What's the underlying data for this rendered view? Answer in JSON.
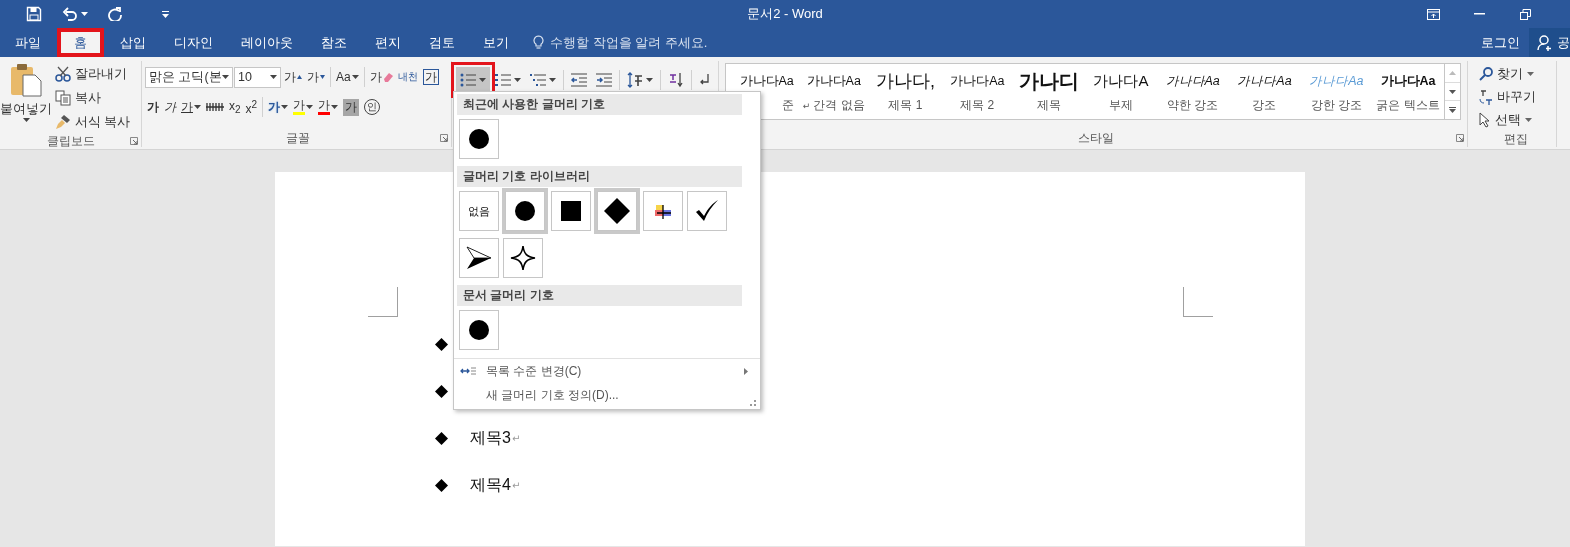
{
  "window": {
    "title": "문서2 - Word"
  },
  "tabs": [
    {
      "label": "파일",
      "selected": false,
      "marked": false
    },
    {
      "label": "홈",
      "selected": true,
      "marked": true
    },
    {
      "label": "삽입",
      "selected": false,
      "marked": false
    },
    {
      "label": "디자인",
      "selected": false,
      "marked": false
    },
    {
      "label": "레이아웃",
      "selected": false,
      "marked": false
    },
    {
      "label": "참조",
      "selected": false,
      "marked": false
    },
    {
      "label": "편지",
      "selected": false,
      "marked": false
    },
    {
      "label": "검토",
      "selected": false,
      "marked": false
    },
    {
      "label": "보기",
      "selected": false,
      "marked": false
    }
  ],
  "tell_me": {
    "placeholder": "수행할 작업을 알려 주세요."
  },
  "account": {
    "sign_in": "로그인",
    "share": "공"
  },
  "clipboard": {
    "paste": "붙여넣기",
    "group_label": "클립보드",
    "actions": [
      {
        "kind": "cut",
        "label": "잘라내기"
      },
      {
        "kind": "copy",
        "label": "복사"
      },
      {
        "kind": "painter",
        "label": "서식 복사"
      }
    ]
  },
  "font": {
    "name": "맑은 고딕(본",
    "size": "10",
    "group_label": "글꼴",
    "row1": [
      {
        "kind": "grow",
        "text": "가",
        "dropdown": false
      },
      {
        "kind": "shrink",
        "text": "가",
        "dropdown": false
      },
      {
        "kind": "sep"
      },
      {
        "kind": "case",
        "text": "Aa",
        "dropdown": true
      },
      {
        "kind": "sep"
      },
      {
        "kind": "clear",
        "text": "가",
        "dropdown": false
      },
      {
        "kind": "phonetic",
        "text": "내천",
        "dropdown": false
      },
      {
        "kind": "border",
        "text": "가",
        "dropdown": false
      }
    ],
    "row2": [
      {
        "kind": "bold",
        "text": "가",
        "dropdown": false
      },
      {
        "kind": "italic",
        "text": "가",
        "dropdown": false
      },
      {
        "kind": "underline",
        "text": "가",
        "dropdown": true
      },
      {
        "kind": "strike",
        "dropdown": false
      },
      {
        "kind": "plain",
        "text": "x$_{2}$",
        "dropdown": false
      },
      {
        "kind": "plain",
        "text": "x$^{2}$",
        "dropdown": false
      },
      {
        "kind": "sep"
      },
      {
        "kind": "effects",
        "text": "가",
        "dropdown": true
      },
      {
        "kind": "highlight",
        "text": "가",
        "dropdown": true
      },
      {
        "kind": "color",
        "text": "가",
        "dropdown": true
      },
      {
        "kind": "shading",
        "text": "가",
        "dropdown": false
      },
      {
        "kind": "enclose",
        "text": "인",
        "dropdown": false
      }
    ]
  },
  "paragraph": {
    "buttons": [
      {
        "kind": "bullets",
        "dropdown": true,
        "marked": true
      },
      {
        "kind": "numbering",
        "dropdown": true,
        "marked": false
      },
      {
        "kind": "multilevel",
        "dropdown": true,
        "marked": false
      },
      {
        "kind": "sep"
      },
      {
        "kind": "outdent",
        "dropdown": false,
        "marked": false
      },
      {
        "kind": "indent",
        "dropdown": false,
        "marked": false
      },
      {
        "kind": "sep"
      },
      {
        "kind": "spacing",
        "dropdown": true,
        "marked": false
      },
      {
        "kind": "sep"
      },
      {
        "kind": "sort",
        "dropdown": false,
        "marked": false
      },
      {
        "kind": "sep"
      },
      {
        "kind": "marks",
        "dropdown": false,
        "marked": false
      }
    ]
  },
  "styles": {
    "group_label": "스타일",
    "items": [
      {
        "preview": "가나다Aa",
        "label": "준",
        "kind": "plain"
      },
      {
        "preview": "가나다Aa",
        "label": "간격 없음",
        "prefix": "↵",
        "kind": "plain"
      },
      {
        "preview": "가나다,",
        "label": "제목 1",
        "kind": "large"
      },
      {
        "preview": "가나다Aa",
        "label": "제목 2",
        "kind": "plain"
      },
      {
        "preview": "가나디",
        "label": "제목",
        "kind": "heavy"
      },
      {
        "preview": "가나다A",
        "label": "부제",
        "kind": "medium"
      },
      {
        "preview": "가나다Aa",
        "label": "약한 강조",
        "kind": "italic"
      },
      {
        "preview": "가나다Aa",
        "label": "강조",
        "kind": "italic"
      },
      {
        "preview": "가나다Aa",
        "label": "강한 강조",
        "kind": "accent"
      },
      {
        "preview": "가나다Aa",
        "label": "굵은 텍스트",
        "kind": "bold"
      }
    ]
  },
  "editing": {
    "group_label": "편집",
    "items": [
      {
        "kind": "find",
        "label": "찾기",
        "dropdown": true
      },
      {
        "kind": "replace",
        "label": "바꾸기",
        "dropdown": false
      },
      {
        "kind": "select",
        "label": "선택",
        "dropdown": true
      }
    ]
  },
  "bullet_menu": {
    "sections": [
      {
        "title": "최근에 사용한 글머리 기호",
        "cells": [
          {
            "kind": "circle",
            "selected": false
          }
        ]
      },
      {
        "title": "글머리 기호 라이브러리",
        "cells": [
          {
            "kind": "none",
            "label": "없음",
            "selected": false
          },
          {
            "kind": "circle",
            "selected": true
          },
          {
            "kind": "square",
            "selected": false
          },
          {
            "kind": "diamond",
            "selected": true
          },
          {
            "kind": "cross",
            "selected": false
          },
          {
            "kind": "check",
            "selected": false
          },
          {
            "kind": "arrowhead",
            "selected": false
          },
          {
            "kind": "star",
            "selected": false
          }
        ]
      },
      {
        "title": "문서 글머리 기호",
        "cells": [
          {
            "kind": "circle",
            "selected": false
          }
        ]
      }
    ],
    "commands": [
      {
        "kind": "level",
        "label": "목록 수준 변경(C)",
        "submenu": true
      },
      {
        "kind": "define",
        "label": "새 글머리 기호 정의(D)...",
        "submenu": false
      }
    ]
  },
  "document": {
    "items": [
      {
        "kind": "diamond"
      },
      {
        "kind": "diamond"
      },
      {
        "kind": "diamond",
        "text": "제목3",
        "end_mark": "↵"
      },
      {
        "kind": "diamond",
        "text": "제목4",
        "end_mark": "↵"
      }
    ]
  }
}
